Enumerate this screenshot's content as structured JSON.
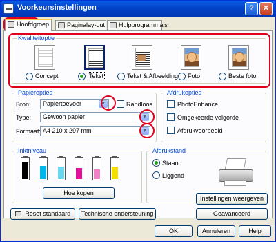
{
  "window": {
    "title": "Voorkeursinstellingen",
    "help_glyph": "?",
    "close_glyph": "✕"
  },
  "tabs": [
    {
      "label": "Hoofdgroep"
    },
    {
      "label": "Paginalay-out"
    },
    {
      "label": "Hulpprogramma's"
    }
  ],
  "quality": {
    "title": "Kwaliteitoptie",
    "options": [
      {
        "label": "Concept",
        "selected": false
      },
      {
        "label": "Tekst",
        "selected": true
      },
      {
        "label": "Tekst & Afbeelding",
        "selected": false
      },
      {
        "label": "Foto",
        "selected": false
      },
      {
        "label": "Beste foto",
        "selected": false
      }
    ]
  },
  "paper": {
    "title": "Papieropties",
    "source_label": "Bron:",
    "source_value": "Papiertoevoer",
    "borderless_label": "Randloos",
    "type_label": "Type:",
    "type_value": "Gewoon papier",
    "format_label": "Formaat:",
    "format_value": "A4 210 x 297 mm"
  },
  "print_options": {
    "title": "Afdrukopties",
    "items": [
      {
        "label": "PhotoEnhance",
        "checked": false
      },
      {
        "label": "Omgekeerde volgorde",
        "checked": false
      },
      {
        "label": "Afdrukvoorbeeld",
        "checked": false
      }
    ]
  },
  "ink": {
    "title": "Inktniveau",
    "buy_button": "Hoe kopen",
    "cartridges": [
      {
        "color": "#000000",
        "level": 0.75
      },
      {
        "color": "#00B7EB",
        "level": 0.6
      },
      {
        "color": "#66D9F0",
        "level": 0.55
      },
      {
        "color": "#E0109A",
        "level": 0.5
      },
      {
        "color": "#F280C8",
        "level": 0.45
      },
      {
        "color": "#F4E000",
        "level": 0.55
      }
    ]
  },
  "orientation": {
    "title": "Afdrukstand",
    "portrait_label": "Staand",
    "landscape_label": "Liggend",
    "selected": "Staand"
  },
  "buttons": {
    "reset": "Reset standaard",
    "tech_support": "Technische ondersteuning",
    "show_settings": "Instellingen weergeven",
    "advanced": "Geavanceerd",
    "ok": "OK",
    "cancel": "Annuleren",
    "help": "Help"
  }
}
